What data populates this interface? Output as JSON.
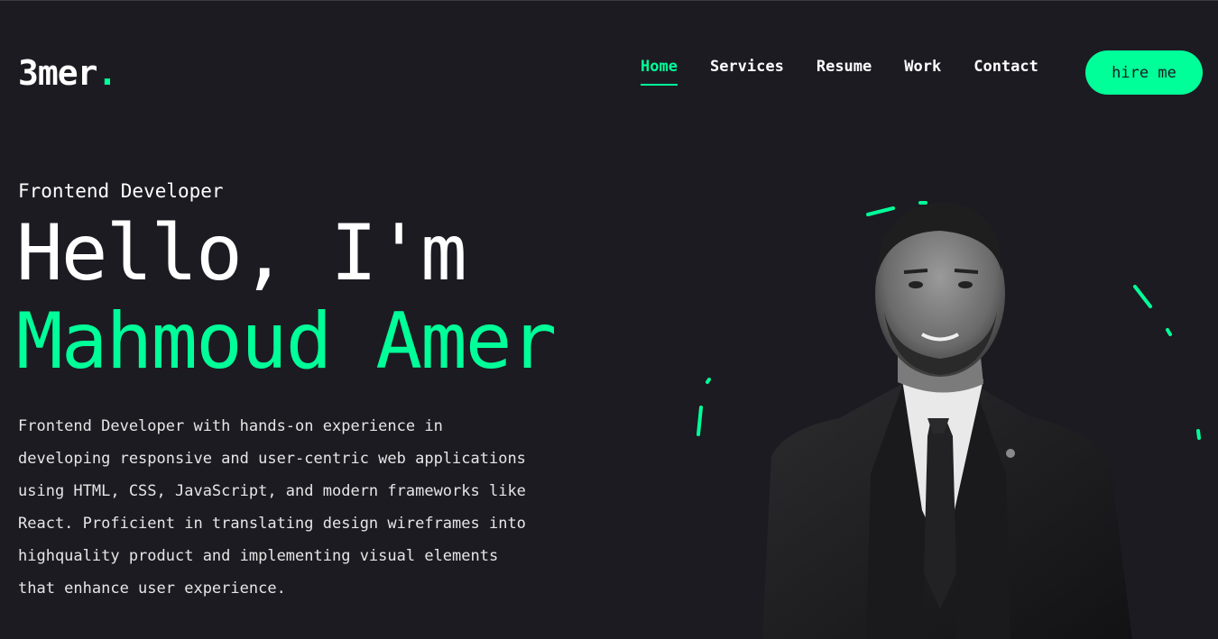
{
  "colors": {
    "accent": "#00ff99",
    "background": "#1c1b22",
    "text": "#ffffff"
  },
  "header": {
    "logo_text": "3mer",
    "logo_dot": ".",
    "nav": [
      {
        "label": "Home",
        "active": true
      },
      {
        "label": "Services",
        "active": false
      },
      {
        "label": "Resume",
        "active": false
      },
      {
        "label": "Work",
        "active": false
      },
      {
        "label": "Contact",
        "active": false
      }
    ],
    "hire_label": "hire me"
  },
  "hero": {
    "role": "Frontend Developer",
    "greeting": "Hello, I'm",
    "name": "Mahmoud Amer",
    "bio": "Frontend Developer with hands-on experience in developing responsive and user-centric web applications using HTML, CSS, JavaScript, and modern frameworks like React. Proficient in translating design wireframes into highquality product and implementing visual elements that enhance user experience."
  },
  "portrait": {
    "icon": "person-photo"
  }
}
